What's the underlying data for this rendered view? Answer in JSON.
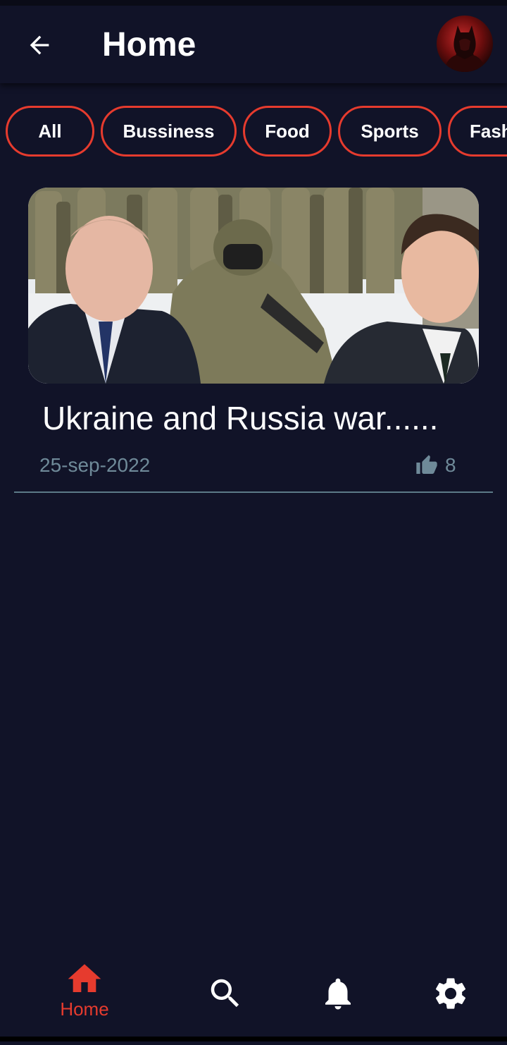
{
  "header": {
    "title": "Home",
    "back_icon": "arrow-left-icon",
    "avatar": "profile-avatar"
  },
  "categories": [
    {
      "label": "All"
    },
    {
      "label": "Bussiness"
    },
    {
      "label": "Food"
    },
    {
      "label": "Sports"
    },
    {
      "label": "Fashion"
    }
  ],
  "news": [
    {
      "title": "Ukraine and Russia war......",
      "date": "25-sep-2022",
      "likes": "8",
      "like_icon": "thumbs-up-icon"
    }
  ],
  "bottom_nav": {
    "items": [
      {
        "label": "Home",
        "icon": "home-icon",
        "active": true
      },
      {
        "label": "",
        "icon": "search-icon",
        "active": false
      },
      {
        "label": "",
        "icon": "bell-icon",
        "active": false
      },
      {
        "label": "",
        "icon": "gear-icon",
        "active": false
      }
    ]
  },
  "colors": {
    "background": "#111328",
    "accent": "#e63b2e",
    "muted": "#6f8a99"
  }
}
